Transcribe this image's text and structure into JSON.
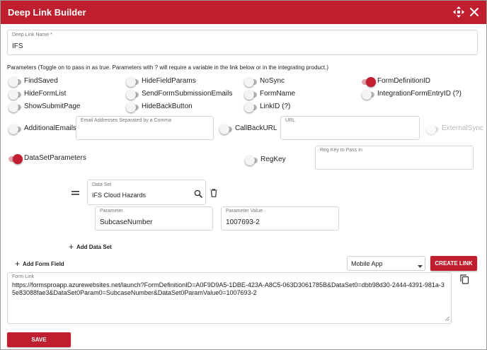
{
  "dialog": {
    "title": "Deep Link Builder"
  },
  "deep_link_name": {
    "label": "Deep Link Name *",
    "value": "IFS"
  },
  "parameters": {
    "heading": "Parameters (Toggle on to pass in as true. Parameters with ? will require a variable in the link below or in the integrating product.)",
    "toggles": [
      {
        "label": "FindSaved",
        "on": false
      },
      {
        "label": "HideFieldParams",
        "on": false
      },
      {
        "label": "NoSync",
        "on": false
      },
      {
        "label": "FormDefinitionID",
        "on": true
      },
      {
        "label": "HideFormList",
        "on": false
      },
      {
        "label": "SendFormSubmissionEmails",
        "on": false
      },
      {
        "label": "FormName",
        "on": false
      },
      {
        "label": "IntegrationFormEntryID (?)",
        "on": false
      },
      {
        "label": "ShowSubmitPage",
        "on": false
      },
      {
        "label": "HideBackButton",
        "on": false
      },
      {
        "label": "LinkID (?)",
        "on": false
      },
      {
        "label": "AdditionalEmails",
        "on": false
      },
      {
        "label": "CallBackURL",
        "on": false
      },
      {
        "label": "ExternalSync",
        "on": false
      },
      {
        "label": "DataSetParameters",
        "on": true
      },
      {
        "label": "RegKey",
        "on": false
      }
    ],
    "email_field": {
      "label": "Email Addresses Separated by a Comma",
      "value": ""
    },
    "url_field": {
      "label": "URL",
      "value": ""
    },
    "regkey_field": {
      "label": "Reg Key to Pass In",
      "value": ""
    }
  },
  "data_set": {
    "label": "Data Set",
    "value": "IFS Cloud Hazards",
    "parameter": {
      "label": "Parameter",
      "value": "SubcaseNumber"
    },
    "parameter_value": {
      "label": "Parameter Value",
      "value": "1007693-2"
    },
    "add_label": "Add Data Set"
  },
  "form": {
    "add_form_field_label": "Add Form Field",
    "platform_select": "Mobile App",
    "create_link_label": "CREATE LINK",
    "form_link_label": "Form Link",
    "form_link_value": "https://formsproapp.azurewebsites.net/launch?FormDefinitionID=A0F9D9A5-1DBE-423A-A8C5-063D3061785B&DataSet0=dbb98d30-2444-4391-981a-35e83088fae3&DataSet0Param0=SubcaseNumber&DataSet0ParamValue0=1007693-2",
    "save_label": "SAVE"
  },
  "colors": {
    "brand_red": "#bf1e2e",
    "toggle_on": "#c31f30"
  }
}
